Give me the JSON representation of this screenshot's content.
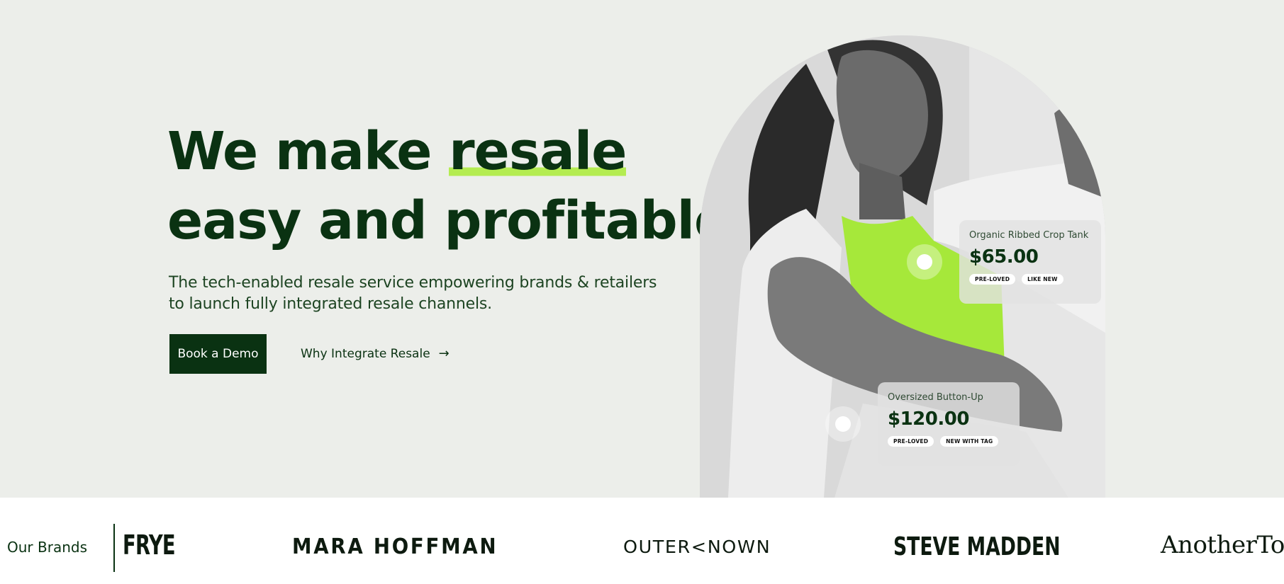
{
  "hero": {
    "headline_line1_prefix": "We make ",
    "headline_highlight": "resale",
    "headline_line2": "easy and profitable.",
    "subtitle_line1": "The tech-enabled resale service empowering brands & retailers",
    "subtitle_line2": "to launch fully integrated resale channels.",
    "primary_cta": "Book a Demo",
    "secondary_cta": "Why Integrate Resale",
    "secondary_cta_icon": "arrow-right-icon",
    "accent_color": "#b4ec51",
    "text_color": "#0a3212"
  },
  "products": [
    {
      "name": "Organic Ribbed Crop Tank",
      "price": "$65.00",
      "tags": [
        "PRE-LOVED",
        "LIKE NEW"
      ]
    },
    {
      "name": "Oversized Button-Up",
      "price": "$120.00",
      "tags": [
        "PRE-LOVED",
        "NEW WITH TAG"
      ]
    }
  ],
  "brands": {
    "label": "Our Brands",
    "logos": [
      "FRYE",
      "MARA HOFFMAN",
      "OUTER<NOWN",
      "STEVE MADDEN",
      "AnotherTom"
    ]
  }
}
